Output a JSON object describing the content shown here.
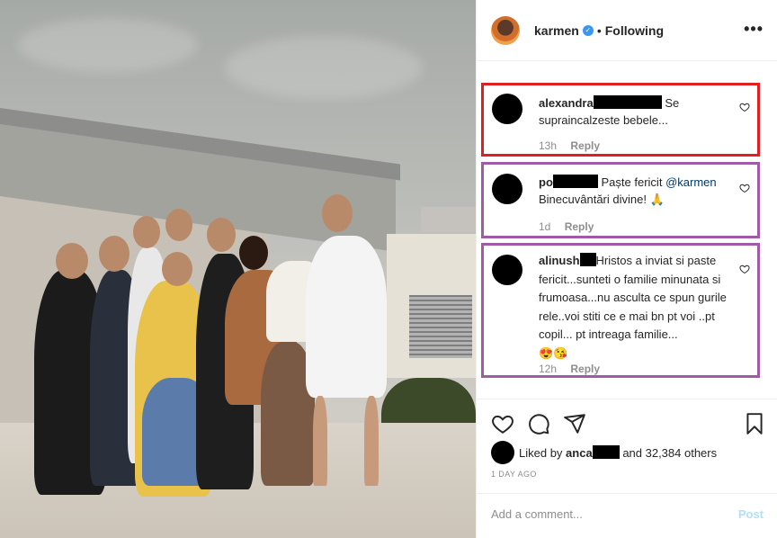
{
  "header": {
    "username": "karmen",
    "separator": "•",
    "follow_status": "Following",
    "more_glyph": "•••",
    "verified_glyph": "✓"
  },
  "comments": [
    {
      "username": "alexandra",
      "text": "Se supraincalzeste bebele...",
      "time": "13h",
      "reply_label": "Reply",
      "border_color": "#e02020"
    },
    {
      "username": "po",
      "text_before": "Paște fericit",
      "mention": "@karmen",
      "text_after": "Binecuvântări divine! 🙏",
      "time": "1d",
      "reply_label": "Reply",
      "border_color": "#a05aa8"
    },
    {
      "username": "alinush",
      "text": "Hristos a inviat si paste fericit...sunteti o familie minunata si frumoasa...nu asculta ce spun gurile rele..voi stiti ce e mai bn pt voi ..pt copil... pt intreaga familie...",
      "emojis": "😍😘",
      "time": "12h",
      "reply_label": "Reply",
      "border_color": "#a05aa8"
    }
  ],
  "likes": {
    "prefix": "Liked by",
    "user": "anca",
    "suffix": "and 32,384 others"
  },
  "time_ago": "1 DAY AGO",
  "add_comment": {
    "placeholder": "Add a comment...",
    "post_label": "Post"
  },
  "icons": {
    "like": "heart-icon",
    "comment": "comment-icon",
    "share": "share-icon",
    "save": "bookmark-icon"
  }
}
